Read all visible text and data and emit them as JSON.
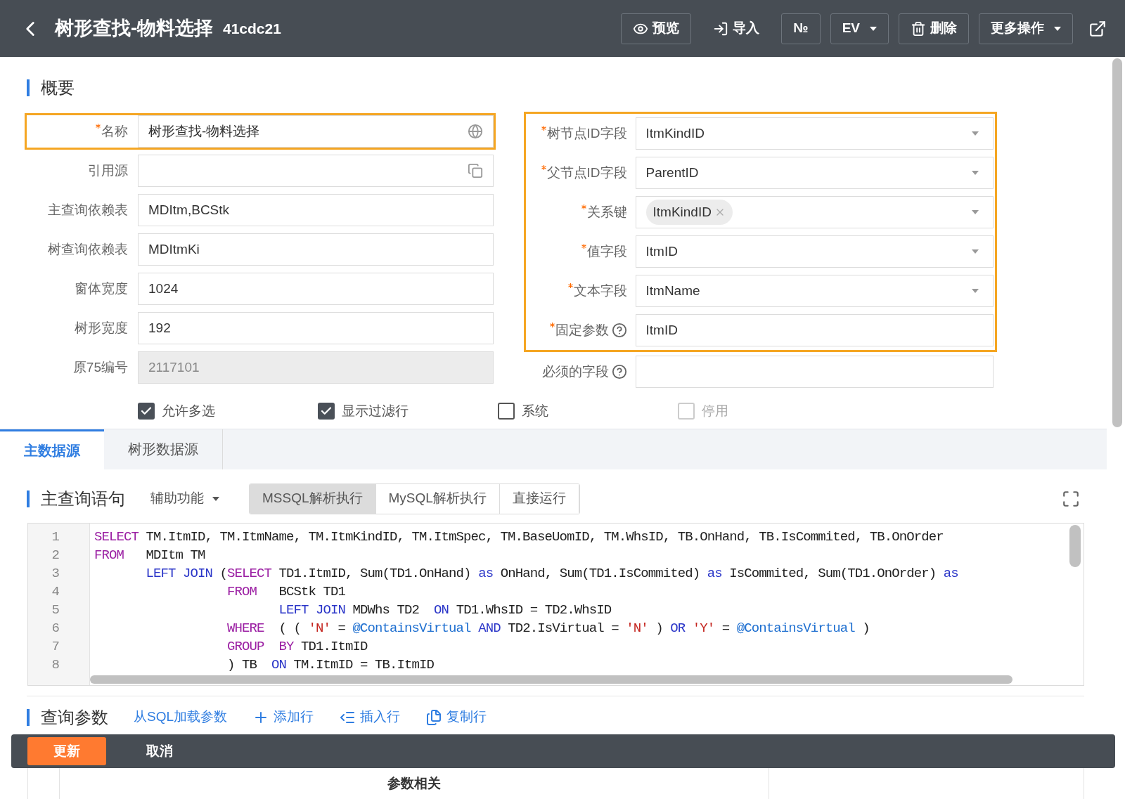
{
  "header": {
    "title": "树形查找-物料选择",
    "code": "41cdc21",
    "buttons": [
      {
        "kind": "preview",
        "label": "预览",
        "bordered": true
      },
      {
        "kind": "import",
        "label": "导入",
        "bordered": false
      },
      {
        "kind": "plain",
        "label": "№",
        "bordered": true
      },
      {
        "kind": "dropdown",
        "label": "EV",
        "bordered": true
      },
      {
        "kind": "delete",
        "label": "删除",
        "bordered": true
      },
      {
        "kind": "dropdown",
        "label": "更多操作",
        "bordered": true
      }
    ]
  },
  "section_title": "概要",
  "left_fields": [
    {
      "label": "名称",
      "required": true,
      "value": "树形查找-物料选择",
      "disabled": false,
      "highlighted": true
    },
    {
      "label": "引用源",
      "required": false,
      "disabled": false,
      "highlighted": false
    },
    {
      "label": "主查询依赖表",
      "required": false,
      "value": "MDItm,BCStk",
      "disabled": false,
      "highlighted": false
    },
    {
      "label": "树查询依赖表",
      "required": false,
      "value": "MDItmKi",
      "disabled": false,
      "highlighted": false
    },
    {
      "label": "窗体宽度",
      "required": false,
      "value": "1024",
      "disabled": false,
      "highlighted": false
    },
    {
      "label": "树形宽度",
      "required": false,
      "value": "192",
      "disabled": false,
      "highlighted": false
    },
    {
      "label": "原75编号",
      "required": false,
      "value": "2117101",
      "disabled": true,
      "highlighted": false
    }
  ],
  "right_fields": [
    {
      "label": "树节点ID字段",
      "required": true,
      "kind": "select",
      "value": "ItmKindID",
      "highlighted": true
    },
    {
      "label": "父节点ID字段",
      "required": true,
      "kind": "select",
      "value": "ParentID",
      "highlighted": true
    },
    {
      "label": "关系键",
      "required": true,
      "kind": "tags",
      "tags": [
        "ItmKindID"
      ],
      "highlighted": true
    },
    {
      "label": "值字段",
      "required": true,
      "kind": "select",
      "value": "ItmID",
      "highlighted": true
    },
    {
      "label": "文本字段",
      "required": true,
      "kind": "select",
      "value": "ItmName",
      "highlighted": true
    },
    {
      "label": "固定参数",
      "required": true,
      "kind": "input",
      "help": true,
      "value": "ItmID",
      "highlighted": true
    },
    {
      "label": "必须的字段",
      "required": false,
      "kind": "input",
      "help": true,
      "highlighted": false
    }
  ],
  "checkboxes": [
    {
      "label": "允许多选",
      "checked": true,
      "disabled": false
    },
    {
      "label": "显示过滤行",
      "checked": true,
      "disabled": false
    },
    {
      "label": "系统",
      "checked": false,
      "disabled": false
    },
    {
      "label": "停用",
      "checked": false,
      "disabled": true
    }
  ],
  "tabs": [
    {
      "label": "主数据源",
      "selected": true
    },
    {
      "label": "树形数据源",
      "selected": false
    }
  ],
  "query": {
    "title": "主查询语句",
    "assist": "辅助功能",
    "modes": [
      {
        "label": "MSSQL解析执行",
        "selected": true
      },
      {
        "label": "MySQL解析执行",
        "selected": false
      },
      {
        "label": "直接运行",
        "selected": false
      }
    ]
  },
  "code_lines": [
    {
      "number": "1",
      "tokens": [
        {
          "kind": "kw",
          "text": "SELECT"
        },
        {
          "kind": "plain",
          "text": " TM.ItmID, TM.ItmName, TM.ItmKindID, TM.ItmSpec, TM.BaseUomID, TM.WhsID, TB.OnHand, TB.IsCommited, TB.OnOrder"
        }
      ]
    },
    {
      "number": "2",
      "tokens": [
        {
          "kind": "kw",
          "text": "FROM"
        },
        {
          "kind": "plain",
          "text": "   MDItm TM"
        }
      ]
    },
    {
      "number": "3",
      "tokens": [
        {
          "kind": "op",
          "text": "       LEFT JOIN"
        },
        {
          "kind": "plain",
          "text": " ("
        },
        {
          "kind": "kw",
          "text": "SELECT"
        },
        {
          "kind": "plain",
          "text": " TD1.ItmID, Sum(TD1.OnHand) "
        },
        {
          "kind": "op",
          "text": "as"
        },
        {
          "kind": "plain",
          "text": " OnHand, Sum(TD1.IsCommited) "
        },
        {
          "kind": "op",
          "text": "as"
        },
        {
          "kind": "plain",
          "text": " IsCommited, Sum(TD1.OnOrder) "
        },
        {
          "kind": "op",
          "text": "as"
        }
      ]
    },
    {
      "number": "4",
      "tokens": [
        {
          "kind": "kw",
          "text": "                  FROM"
        },
        {
          "kind": "plain",
          "text": "   BCStk TD1"
        }
      ]
    },
    {
      "number": "5",
      "tokens": [
        {
          "kind": "op",
          "text": "                         LEFT JOIN"
        },
        {
          "kind": "plain",
          "text": " MDWhs TD2  "
        },
        {
          "kind": "op",
          "text": "ON"
        },
        {
          "kind": "plain",
          "text": " TD1.WhsID = TD2.WhsID"
        }
      ]
    },
    {
      "number": "6",
      "tokens": [
        {
          "kind": "kw",
          "text": "                  WHERE"
        },
        {
          "kind": "plain",
          "text": "  ( ( "
        },
        {
          "kind": "str",
          "text": "'N'"
        },
        {
          "kind": "plain",
          "text": " = "
        },
        {
          "kind": "var",
          "text": "@ContainsVirtual"
        },
        {
          "kind": "op",
          "text": " AND"
        },
        {
          "kind": "plain",
          "text": " TD2.IsVirtual = "
        },
        {
          "kind": "str",
          "text": "'N'"
        },
        {
          "kind": "plain",
          "text": " ) "
        },
        {
          "kind": "op",
          "text": "OR"
        },
        {
          "kind": "str",
          "text": " 'Y'"
        },
        {
          "kind": "plain",
          "text": " = "
        },
        {
          "kind": "var",
          "text": "@ContainsVirtual"
        },
        {
          "kind": "plain",
          "text": " )"
        }
      ]
    },
    {
      "number": "7",
      "tokens": [
        {
          "kind": "kw",
          "text": "                  GROUP"
        },
        {
          "kind": "kw",
          "text": "  BY"
        },
        {
          "kind": "plain",
          "text": " TD1.ItmID"
        }
      ]
    },
    {
      "number": "8",
      "tokens": [
        {
          "kind": "plain",
          "text": "                  ) TB  "
        },
        {
          "kind": "op",
          "text": "ON"
        },
        {
          "kind": "plain",
          "text": " TM.ItmID = TB.ItmID"
        }
      ]
    }
  ],
  "params": {
    "title": "查询参数",
    "actions": [
      {
        "kind": "load",
        "label": "从SQL加载参数"
      },
      {
        "kind": "add",
        "label": "添加行"
      },
      {
        "kind": "insert",
        "label": "插入行"
      },
      {
        "kind": "copy",
        "label": "复制行"
      }
    ],
    "table_header": "参数相关"
  },
  "footer": {
    "buttons": [
      {
        "label": "更新",
        "primary": true
      },
      {
        "label": "取消",
        "primary": false
      }
    ]
  }
}
